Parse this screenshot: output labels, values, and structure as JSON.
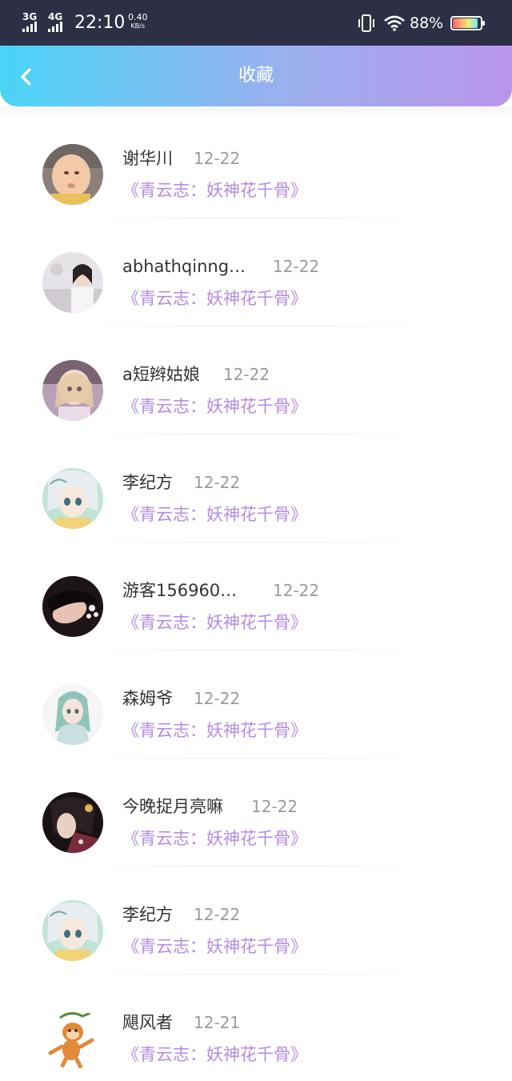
{
  "status_bar": {
    "network_1": "3G",
    "network_2": "4G",
    "time": "22:10",
    "speed_value": "0.40",
    "speed_unit": "KB/s",
    "battery_percent": "88%",
    "icons": [
      "signal-icon",
      "vibrate-icon",
      "wifi-icon",
      "battery-icon"
    ]
  },
  "header": {
    "title": "收藏",
    "back_icon": "chevron-left-icon",
    "gradient_colors": [
      "#49d4f6",
      "#9ab0ef",
      "#bb95eb"
    ]
  },
  "colors": {
    "name_text": "#333333",
    "date_text": "#9a9a9a",
    "book_text": "#b58ae3"
  },
  "favorites": [
    {
      "name": "谢华川",
      "date": "12-22",
      "book": "《青云志：妖神花千骨》"
    },
    {
      "name": "abhathqinng…",
      "date": "12-22",
      "book": "《青云志：妖神花千骨》"
    },
    {
      "name": "a短辫姑娘",
      "date": "12-22",
      "book": "《青云志：妖神花千骨》"
    },
    {
      "name": "李纪方",
      "date": "12-22",
      "book": "《青云志：妖神花千骨》"
    },
    {
      "name": "游客156960…",
      "date": "12-22",
      "book": "《青云志：妖神花千骨》"
    },
    {
      "name": "森姆爷",
      "date": "12-22",
      "book": "《青云志：妖神花千骨》"
    },
    {
      "name": "今晚捉月亮嘛",
      "date": "12-22",
      "book": "《青云志：妖神花千骨》"
    },
    {
      "name": "李纪方",
      "date": "12-22",
      "book": "《青云志：妖神花千骨》"
    },
    {
      "name": "飓风者",
      "date": "12-21",
      "book": "《青云志：妖神花千骨》"
    }
  ]
}
